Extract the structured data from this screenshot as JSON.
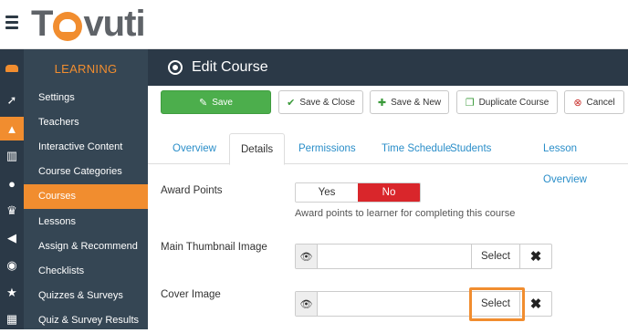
{
  "app": {
    "logo_text_1": "T",
    "logo_text_2": "vuti",
    "logo_mark": "orange-circle-elephant"
  },
  "rail": {
    "icons": [
      "cake-icon",
      "rocket-icon",
      "graduation-cap-icon",
      "bar-chart-icon",
      "users-icon",
      "trophy-icon",
      "megaphone-icon",
      "rss-icon",
      "star-icon",
      "table-icon"
    ]
  },
  "menu": {
    "header": "LEARNING",
    "items": [
      {
        "label": "Settings"
      },
      {
        "label": "Teachers"
      },
      {
        "label": "Interactive Content"
      },
      {
        "label": "Course Categories"
      },
      {
        "label": "Courses"
      },
      {
        "label": "Lessons"
      },
      {
        "label": "Assign & Recommend"
      },
      {
        "label": "Checklists"
      },
      {
        "label": "Quizzes & Surveys"
      },
      {
        "label": "Quiz & Survey Results"
      }
    ],
    "active_index": 4
  },
  "page": {
    "title": "Edit Course"
  },
  "toolbar": {
    "save": "Save",
    "save_close": "Save & Close",
    "save_new": "Save & New",
    "duplicate": "Duplicate Course",
    "cancel": "Cancel"
  },
  "tabs": {
    "items": [
      "Overview",
      "Details",
      "Permissions",
      "Time Schedule",
      "Students",
      "Lesson Overview"
    ],
    "active_index": 1
  },
  "form": {
    "award_points": {
      "label": "Award Points",
      "yes": "Yes",
      "no": "No",
      "selected": "No",
      "help": "Award points to learner for completing this course"
    },
    "main_thumbnail": {
      "label": "Main Thumbnail Image",
      "value": "",
      "select": "Select",
      "clear": "✖"
    },
    "cover_image": {
      "label": "Cover Image",
      "value": "",
      "select": "Select",
      "clear": "✖"
    }
  },
  "colors": {
    "accent": "#f18d2f",
    "nav_dark": "#2b3947",
    "menu_bg": "#354654",
    "save_green": "#4cae4c",
    "no_red": "#d9262b",
    "link_blue": "#2a8ec9"
  }
}
